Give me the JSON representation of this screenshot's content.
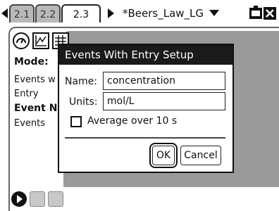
{
  "tabs": [
    {
      "label": "2.1"
    },
    {
      "label": "2.2"
    },
    {
      "label": "2.3"
    }
  ],
  "document": {
    "title": "*Beers_Law_LG"
  },
  "side_panel": {
    "mode_label": "Mode:",
    "line1": "Events w",
    "line2": "Entry",
    "line3": "Event Na",
    "line4": "Events"
  },
  "dialog": {
    "title": "Events With Entry Setup",
    "name_label": "Name:",
    "name_value": "concentration",
    "units_label": "Units:",
    "units_value": "mol/L",
    "average_label": "Average over 10 s",
    "ok_label": "OK",
    "cancel_label": "Cancel"
  }
}
